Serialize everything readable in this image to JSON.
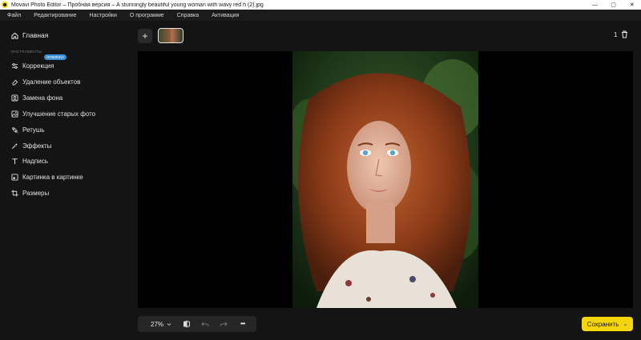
{
  "window": {
    "title": "Movavi Photo Editor – Пробная версия – A stunningly beautiful young woman with wavy red h (2).jpg",
    "controls": [
      "—",
      "▢",
      "✕"
    ]
  },
  "menu": [
    "Файл",
    "Редактирование",
    "Настройки",
    "О программе",
    "Справка",
    "Активация"
  ],
  "sidebar": {
    "home": "Главная",
    "section": "ИНСТРУМЕНТЫ",
    "badge": "НОВИНКА",
    "tools": [
      {
        "label": "Коррекция",
        "icon": "sliders-icon"
      },
      {
        "label": "Удаление объектов",
        "icon": "eraser-icon"
      },
      {
        "label": "Замена фона",
        "icon": "portrait-icon"
      },
      {
        "label": "Улучшение старых фото",
        "icon": "old-photo-icon"
      },
      {
        "label": "Ретушь",
        "icon": "retouch-icon"
      },
      {
        "label": "Эффекты",
        "icon": "magic-wand-icon"
      },
      {
        "label": "Надпись",
        "icon": "text-icon"
      },
      {
        "label": "Картинка в картинке",
        "icon": "picture-in-picture-icon"
      },
      {
        "label": "Размеры",
        "icon": "crop-icon"
      }
    ]
  },
  "toolbar": {
    "add": "+",
    "count": "1"
  },
  "bottom": {
    "zoom": "27%",
    "more": "•••",
    "save": "Сохранить",
    "save_chevron": "⌄"
  },
  "colors": {
    "accent": "#f5d50c",
    "badge": "#3a8fd6",
    "background": "#141414"
  }
}
